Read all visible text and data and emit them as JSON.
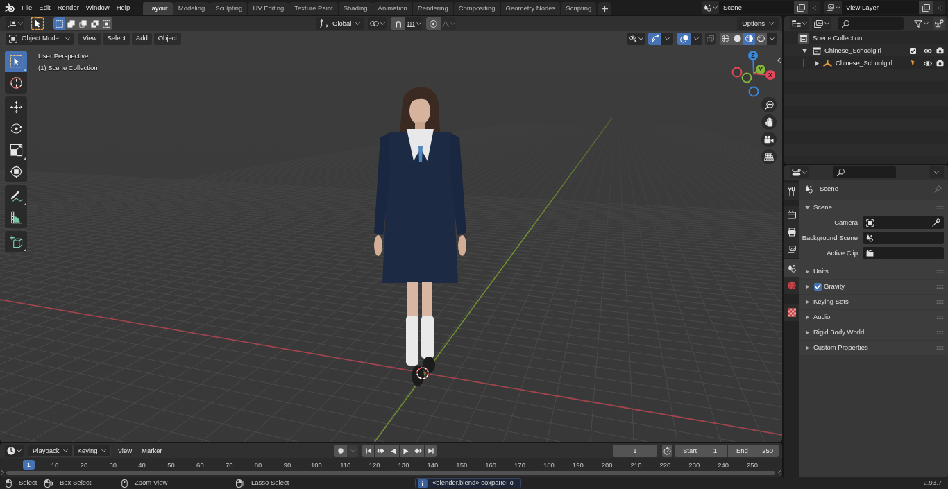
{
  "top_bar": {
    "menus": [
      "File",
      "Edit",
      "Render",
      "Window",
      "Help"
    ],
    "workspaces": [
      {
        "label": "Layout",
        "selected": true
      },
      {
        "label": "Modeling",
        "selected": false
      },
      {
        "label": "Sculpting",
        "selected": false
      },
      {
        "label": "UV Editing",
        "selected": false
      },
      {
        "label": "Texture Paint",
        "selected": false
      },
      {
        "label": "Shading",
        "selected": false
      },
      {
        "label": "Animation",
        "selected": false
      },
      {
        "label": "Rendering",
        "selected": false
      },
      {
        "label": "Compositing",
        "selected": false
      },
      {
        "label": "Geometry Nodes",
        "selected": false
      },
      {
        "label": "Scripting",
        "selected": false
      }
    ],
    "scene": "Scene",
    "view_layer": "View Layer"
  },
  "tool_settings": {
    "select_modes": [
      {
        "selected": true
      },
      {
        "selected": false
      },
      {
        "selected": false
      },
      {
        "selected": false
      },
      {
        "selected": false
      }
    ],
    "orientation": "Global",
    "snap": {
      "on": false
    },
    "proportional_edit": {
      "on": false
    },
    "options": "Options"
  },
  "viewport_header": {
    "mode": "Object Mode",
    "menus": [
      "View",
      "Select",
      "Add",
      "Object"
    ],
    "gizmos": {
      "on": true
    },
    "overlays": {
      "on": true
    },
    "xray": {
      "on": false
    },
    "shading": [
      {
        "selected": false
      },
      {
        "selected": false
      },
      {
        "selected": true
      },
      {
        "selected": false
      }
    ]
  },
  "viewport": {
    "info": [
      "User Perspective",
      "(1) Scene Collection"
    ],
    "toolbar": {
      "groups": [
        {
          "tools": [
            {
              "selected": true
            },
            {
              "selected": false
            }
          ]
        },
        {
          "tools": [
            {
              "selected": false
            },
            {
              "selected": false
            },
            {
              "selected": false
            },
            {
              "selected": false
            }
          ]
        },
        {
          "tools": [
            {
              "selected": false
            },
            {
              "selected": false
            }
          ]
        },
        {
          "tools": [
            {
              "selected": false
            }
          ]
        }
      ]
    },
    "gizmo_axes": [
      "X",
      "Y",
      "Z"
    ]
  },
  "outliner": {
    "tree": [
      {
        "label": "Scene Collection",
        "kind": "scene_collection",
        "children": [
          {
            "label": "Chinese_Schoolgirl",
            "kind": "collection",
            "expanded": true,
            "checked": true,
            "visible": true,
            "renderable": true,
            "children": [
              {
                "label": "Chinese_Schoolgirl",
                "kind": "armature",
                "expanded": false,
                "visible": true,
                "renderable": true
              }
            ]
          }
        ]
      }
    ]
  },
  "properties": {
    "tabs": [
      {
        "selected": false
      },
      {
        "selected": false
      },
      {
        "selected": false
      },
      {
        "selected": false
      },
      {
        "selected": true
      },
      {
        "selected": false
      },
      {
        "selected": false
      }
    ],
    "context": "Scene",
    "panels": [
      {
        "kind": "plain",
        "title": "Scene",
        "expanded": true,
        "fields": [
          {
            "label": "Camera"
          },
          {
            "label": "Background Scene"
          },
          {
            "label": "Active Clip"
          }
        ]
      },
      {
        "kind": "plain",
        "title": "Units",
        "expanded": false
      },
      {
        "kind": "checkbox",
        "title": "Gravity",
        "expanded": false,
        "checked": true
      },
      {
        "kind": "plain",
        "title": "Keying Sets",
        "expanded": false
      },
      {
        "kind": "plain",
        "title": "Audio",
        "expanded": false
      },
      {
        "kind": "plain",
        "title": "Rigid Body World",
        "expanded": false
      },
      {
        "kind": "plain",
        "title": "Custom Properties",
        "expanded": false
      }
    ]
  },
  "timeline": {
    "menus": [
      {
        "label": "Playback",
        "kind": "dropdown"
      },
      {
        "label": "Keying",
        "kind": "dropdown"
      },
      {
        "label": "View",
        "kind": "menu"
      },
      {
        "label": "Marker",
        "kind": "menu"
      }
    ],
    "auto_keying": {
      "on": false
    },
    "current_frame": "1",
    "preview_range": {
      "on": false
    },
    "start": {
      "label": "Start",
      "value": "1"
    },
    "end": {
      "label": "End",
      "value": "250"
    },
    "ruler": {
      "marker": "1",
      "labels": [
        "10",
        "20",
        "30",
        "40",
        "50",
        "60",
        "70",
        "80",
        "90",
        "100",
        "110",
        "120",
        "130",
        "140",
        "150",
        "160",
        "170",
        "180",
        "190",
        "200",
        "210",
        "220",
        "230",
        "240",
        "250"
      ]
    }
  },
  "status_bar": {
    "hints": [
      "Select",
      "Box Select",
      "Zoom View",
      "Lasso Select"
    ],
    "report": "«blender.blend» сохранено",
    "version": "2.93.7"
  }
}
